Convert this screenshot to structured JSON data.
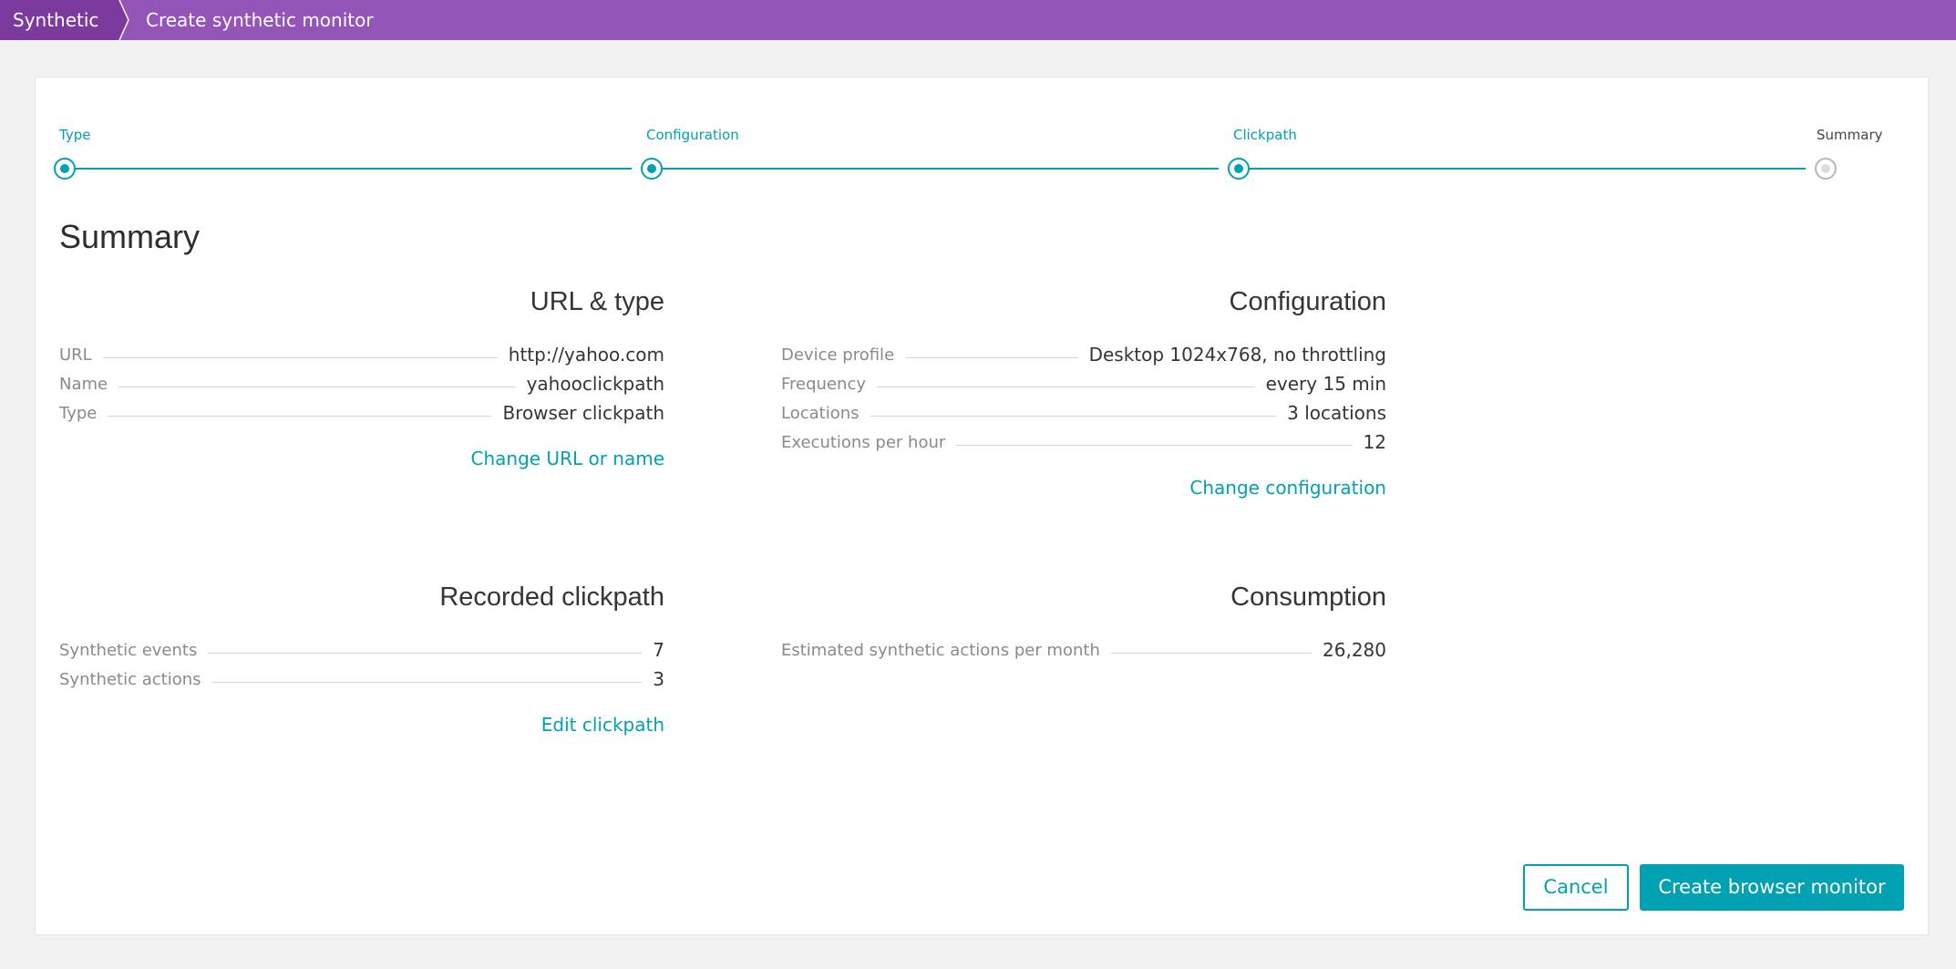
{
  "breadcrumb": {
    "root": "Synthetic",
    "current": "Create synthetic monitor"
  },
  "stepper": {
    "steps": [
      {
        "label": "Type",
        "status": "done"
      },
      {
        "label": "Configuration",
        "status": "done"
      },
      {
        "label": "Clickpath",
        "status": "done"
      },
      {
        "label": "Summary",
        "status": "current"
      }
    ]
  },
  "summary": {
    "title": "Summary",
    "url_type": {
      "title": "URL & type",
      "rows": [
        {
          "label": "URL",
          "value": "http://yahoo.com"
        },
        {
          "label": "Name",
          "value": "yahooclickpath"
        },
        {
          "label": "Type",
          "value": "Browser clickpath"
        }
      ],
      "link": "Change URL or name"
    },
    "configuration": {
      "title": "Configuration",
      "rows": [
        {
          "label": "Device profile",
          "value": "Desktop 1024x768, no throttling"
        },
        {
          "label": "Frequency",
          "value": "every 15 min"
        },
        {
          "label": "Locations",
          "value": "3 locations"
        },
        {
          "label": "Executions per hour",
          "value": "12"
        }
      ],
      "link": "Change configuration"
    },
    "clickpath": {
      "title": "Recorded clickpath",
      "rows": [
        {
          "label": "Synthetic events",
          "value": "7"
        },
        {
          "label": "Synthetic actions",
          "value": "3"
        }
      ],
      "link": "Edit clickpath"
    },
    "consumption": {
      "title": "Consumption",
      "rows": [
        {
          "label": "Estimated synthetic actions per month",
          "value": "26,280"
        }
      ]
    }
  },
  "buttons": {
    "cancel": "Cancel",
    "create": "Create browser monitor"
  },
  "colors": {
    "header": "#9355b7",
    "header_root": "#7c3a9f",
    "accent": "#00a1b2"
  }
}
